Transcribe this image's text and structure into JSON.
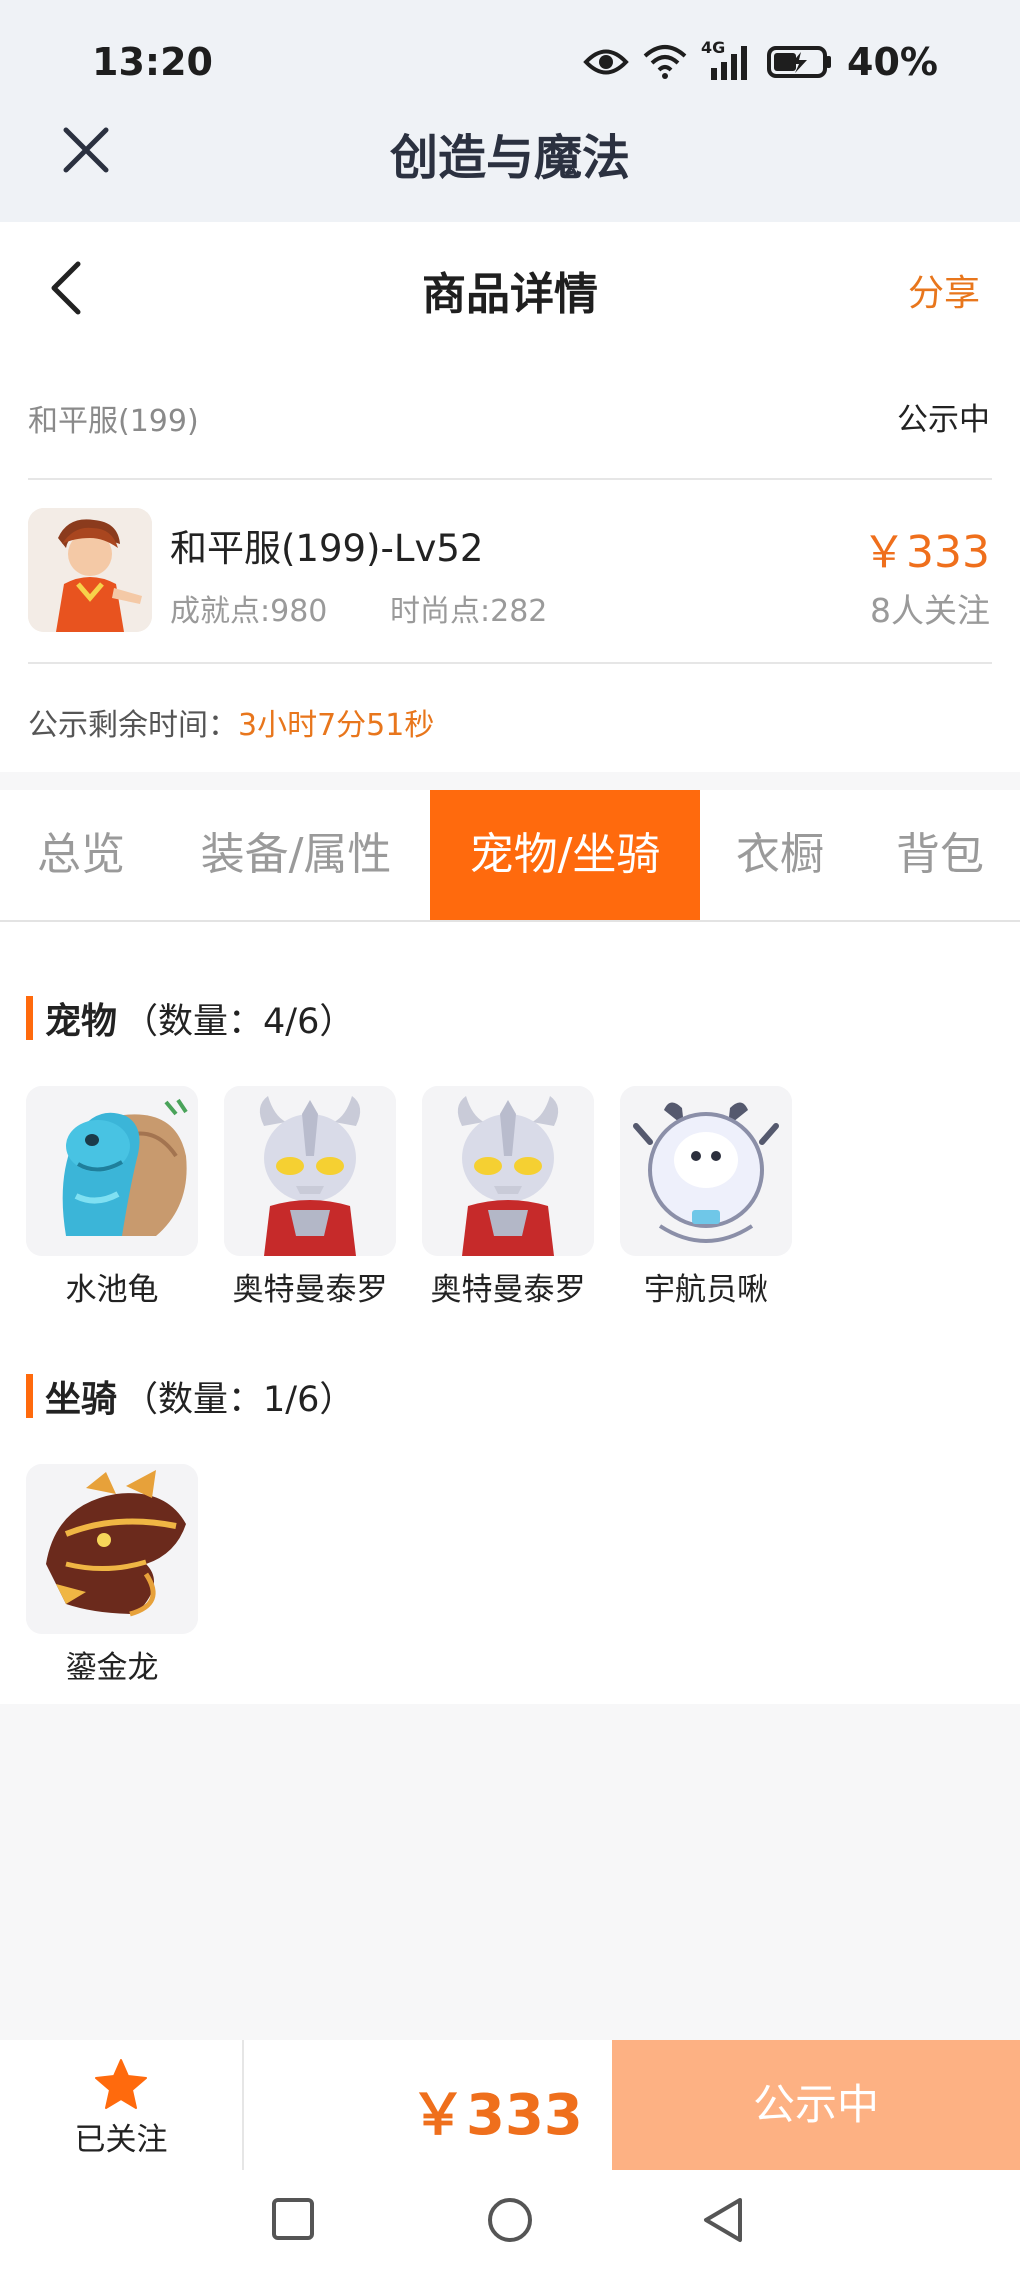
{
  "status_bar": {
    "time": "13:20",
    "network": "4G",
    "battery": "40%"
  },
  "app": {
    "title": "创造与魔法"
  },
  "nav": {
    "title": "商品详情",
    "share": "分享"
  },
  "info": {
    "server": "和平服(199)",
    "status": "公示中",
    "item_name": "和平服(199)-Lv52",
    "achievement": "成就点:980",
    "fashion": "时尚点:282",
    "price": "￥333",
    "watchers": "8人关注",
    "timer_label": "公示剩余时间：",
    "timer_value": "3小时7分51秒"
  },
  "tabs": [
    {
      "label": "总览"
    },
    {
      "label": "装备/属性"
    },
    {
      "label": "宠物/坐骑",
      "active": true
    },
    {
      "label": "衣橱"
    },
    {
      "label": "背包"
    }
  ],
  "pets": {
    "title": "宠物",
    "count": "（数量：4/6）",
    "items": [
      {
        "name": "水池龟",
        "icon": "turtle-pet-icon"
      },
      {
        "name": "奥特曼泰罗",
        "icon": "ultraman-pet-icon"
      },
      {
        "name": "奥特曼泰罗",
        "icon": "ultraman-pet-icon"
      },
      {
        "name": "宇航员啾",
        "icon": "astronaut-pet-icon"
      }
    ]
  },
  "mounts": {
    "title": "坐骑",
    "count": "（数量：1/6）",
    "items": [
      {
        "name": "鎏金龙",
        "icon": "dragon-mount-icon"
      }
    ]
  },
  "bottom": {
    "follow_label": "已关注",
    "price": "￥333",
    "action": "公示中"
  },
  "colors": {
    "accent": "#ff6a0d",
    "price": "#ef6f1c",
    "button_disabled": "#fdb183"
  }
}
